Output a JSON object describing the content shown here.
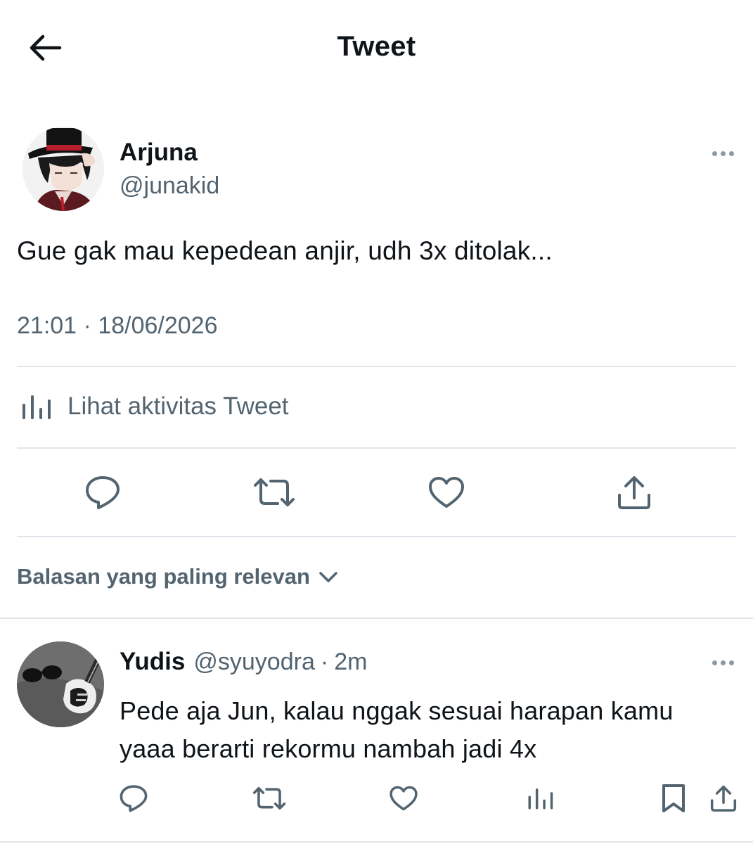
{
  "header": {
    "title": "Tweet",
    "back_icon": "arrow-left-icon"
  },
  "tweet": {
    "author_name": "Arjuna",
    "author_handle": "@junakid",
    "text": "Gue gak mau kepedean anjir, udh 3x ditolak...",
    "time": "21:01",
    "date": "18/06/2026",
    "meta_separator": " · ",
    "activity_label": "Lihat aktivitas Tweet",
    "actions": [
      "reply-icon",
      "retweet-icon",
      "like-icon",
      "share-icon"
    ]
  },
  "replies_sort": {
    "label": "Balasan yang paling relevan"
  },
  "reply": {
    "author_name": "Yudis",
    "author_handle": "@syuyodra",
    "separator": "·",
    "time": "2m",
    "text_line1": "Pede aja Jun, kalau nggak sesuai harapan kamu",
    "text_line2": "yaaa berarti rekormu nambah jadi 4x",
    "actions": [
      "reply-icon",
      "retweet-icon",
      "like-icon",
      "views-icon",
      "bookmark-icon",
      "share-icon"
    ]
  },
  "colors": {
    "text_primary": "#0f1419",
    "text_secondary": "#536471",
    "divider": "#dfe5ea",
    "background": "#ffffff"
  }
}
